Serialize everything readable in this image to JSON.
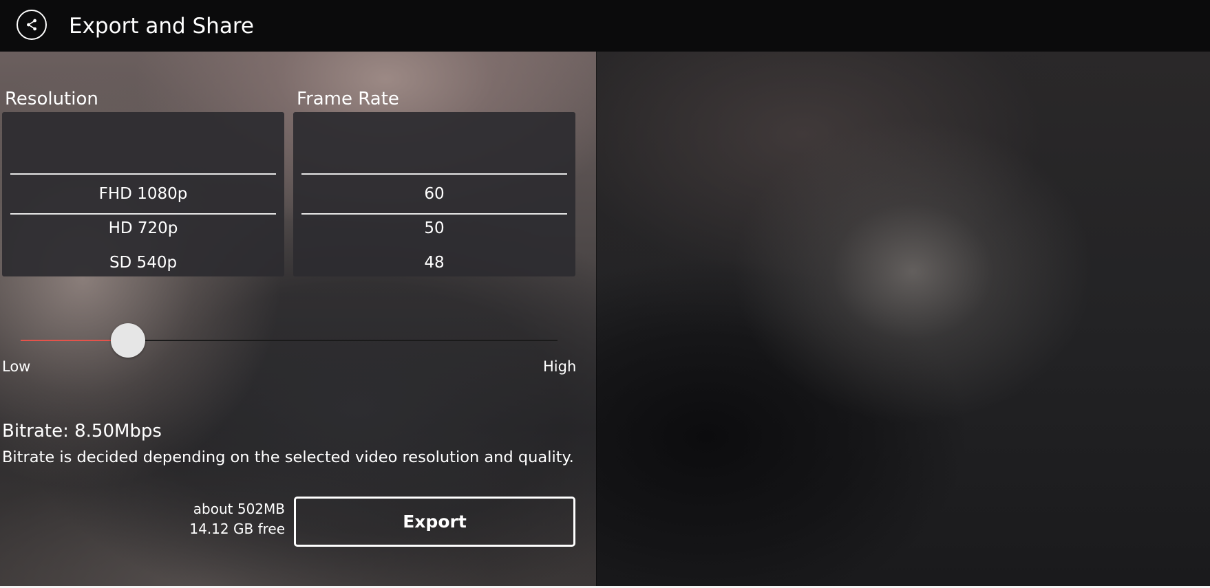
{
  "header": {
    "title": "Export and Share",
    "back_icon": "share-icon"
  },
  "resolution": {
    "label": "Resolution",
    "options": [
      "FHD 1080p",
      "HD 720p",
      "SD 540p"
    ],
    "selected": "FHD 1080p"
  },
  "frame_rate": {
    "label": "Frame Rate",
    "options": [
      "60",
      "50",
      "48"
    ],
    "selected": "60"
  },
  "quality_slider": {
    "low_label": "Low",
    "high_label": "High",
    "value_fraction": 0.2,
    "fill_color": "#e5534b"
  },
  "bitrate": {
    "value_text": "Bitrate: 8.50Mbps",
    "description": "Bitrate is decided depending on the selected video resolution and quality."
  },
  "export": {
    "estimated_size": "about 502MB",
    "free_space": "14.12 GB free",
    "button_label": "Export"
  }
}
